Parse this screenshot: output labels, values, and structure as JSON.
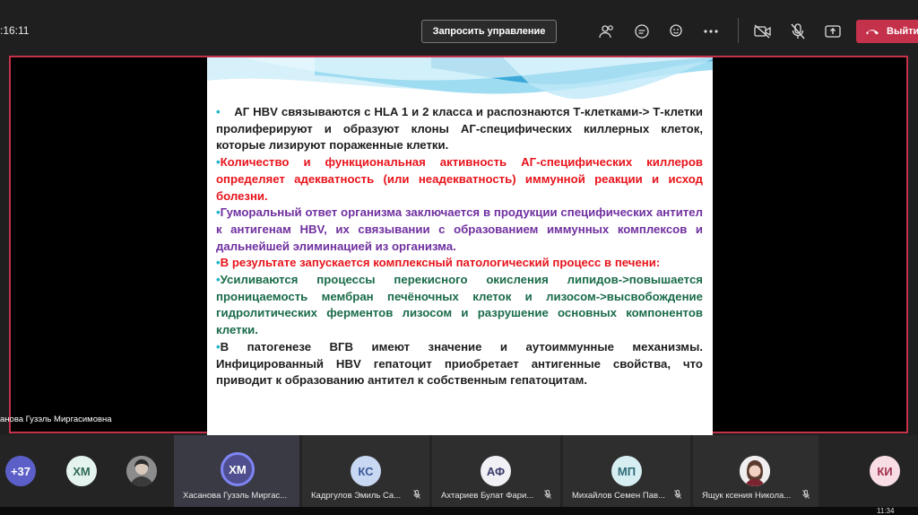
{
  "header": {
    "timer": ":16:11",
    "request_control": "Запросить управление",
    "leave_label": "Выйти",
    "colors": {
      "leave": "#c4314b"
    }
  },
  "slide": {
    "paragraphs": [
      {
        "color": "black",
        "text": "АГ HBV связываются с HLA 1 и 2 класса и распознаются Т-клетками-> Т-клетки пролиферируют и образуют клоны АГ-специфических киллерных клеток, которые лизируют пораженные клетки."
      },
      {
        "color": "red",
        "text": "Количество и функциональная активность АГ-специфических киллеров определяет адекватность (или неадекватность) иммунной реакции и исход болезни."
      },
      {
        "color": "purple",
        "text": "Гуморальный ответ организма заключается в продукции специфических антител к антигенам HBV, их связывании с образованием иммунных комплексов и дальнейшей элиминацией из организма."
      },
      {
        "color": "red",
        "text": "В результате запускается комплексный патологический процесс в печени:"
      },
      {
        "color": "green",
        "text": "Усиливаются процессы перекисного окисления липидов->повышается проницаемость мембран печёночных клеток и лизосом->высвобождение гидролитических ферментов лизосом и разрушение основных компонентов клетки."
      },
      {
        "color": "black",
        "text": "В патогенезе ВГВ имеют значение и аутоиммунные механизмы. Инфицированный HBV гепатоцит приобретает антигенные свойства, что приводит к образованию антител к собственным гепатоцитам."
      }
    ]
  },
  "presenter_label": "анова Гузэль Миргасимовна",
  "participants": {
    "more_count": "+37",
    "tiles": [
      {
        "initials": "ХМ",
        "name": ""
      },
      {
        "initials": "",
        "name": ""
      },
      {
        "initials": "ХМ",
        "name": "Хасанова Гузэль Миргас..."
      },
      {
        "initials": "КС",
        "name": "Кадргулов Эмиль Са..."
      },
      {
        "initials": "АФ",
        "name": "Ахтариев Булат Фари..."
      },
      {
        "initials": "МП",
        "name": "Михайлов Семен Пав..."
      },
      {
        "initials": "",
        "name": "Ящук ксения Никола..."
      },
      {
        "initials": "КИ",
        "name": ""
      }
    ]
  },
  "taskbar": {
    "time": "11:34"
  }
}
